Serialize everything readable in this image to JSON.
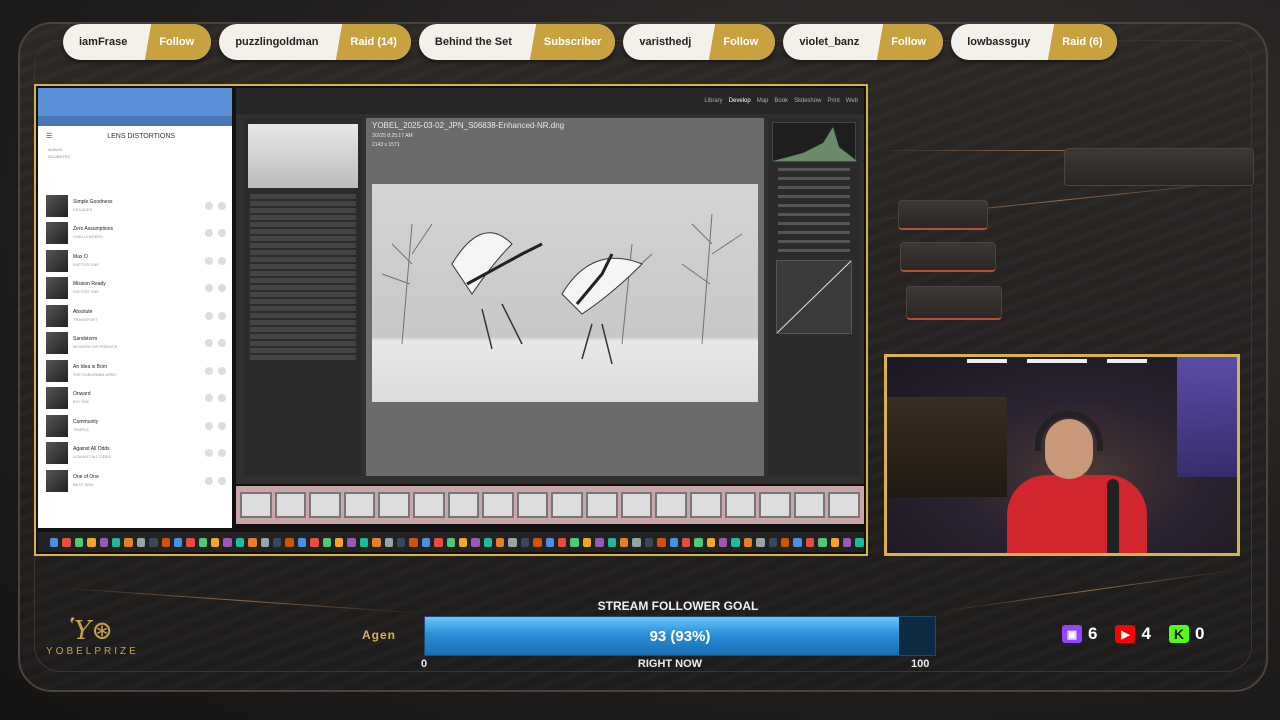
{
  "alerts": [
    {
      "name": "iamFrase",
      "action": "Follow"
    },
    {
      "name": "puzzlingoldman",
      "action": "Raid (14)"
    },
    {
      "name": "Behind the Set",
      "action": "Subscriber"
    },
    {
      "name": "varisthedj",
      "action": "Follow"
    },
    {
      "name": "violet_banz",
      "action": "Follow"
    },
    {
      "name": "lowbassguy",
      "action": "Raid (6)"
    }
  ],
  "browser": {
    "header": "LENS DISTORTIONS",
    "sub1": "ALBUM",
    "sub2": "SOUNDTEC",
    "tracks": [
      {
        "title": "Simple Goodness",
        "artist": "DECADES"
      },
      {
        "title": "Zero Assumptions",
        "artist": "CHALLENGERS"
      },
      {
        "title": "Max O",
        "artist": "FACTOR ONE"
      },
      {
        "title": "Mission Ready",
        "artist": "FACTOR ONE"
      },
      {
        "title": "Absolute",
        "artist": "TRANSPORT"
      },
      {
        "title": "Sandstorm",
        "artist": "MODERN DIFFERENCE"
      },
      {
        "title": "An Idea is Born",
        "artist": "THE SUBURBAN ARMY"
      },
      {
        "title": "Onward",
        "artist": "BIG SHE"
      },
      {
        "title": "Community",
        "artist": "TEMPLE"
      },
      {
        "title": "Against All Odds",
        "artist": "AGAINST ALL ODDS"
      },
      {
        "title": "One of One",
        "artist": "BEST SON"
      }
    ]
  },
  "lightroom": {
    "modules": [
      "Library",
      "Develop",
      "Map",
      "Book",
      "Slideshow",
      "Print",
      "Web"
    ],
    "active_module": "Develop",
    "filename": "YOBEL_2025-03-02_JPN_S06838-Enhanced-NR.dng",
    "meta1": "3/2/25 8:25:17 AM",
    "meta2": "2143 x 1571"
  },
  "overlay": {
    "logo_text": "YOBELPRIZE",
    "ticker": "Agen",
    "goal_title": "STREAM FOLLOWER GOAL",
    "goal_value": "93 (93%)",
    "goal_fraction": 0.93,
    "goal_min": "0",
    "goal_max": "100",
    "goal_caption": "RIGHT NOW",
    "twitch_count": "6",
    "youtube_count": "4",
    "kick_count": "0",
    "colors": {
      "gold": "#d8b24a",
      "goal_blue": "#2b8fd8",
      "twitch": "#9146ff",
      "youtube": "#ff0000",
      "kick": "#53fc18"
    }
  }
}
